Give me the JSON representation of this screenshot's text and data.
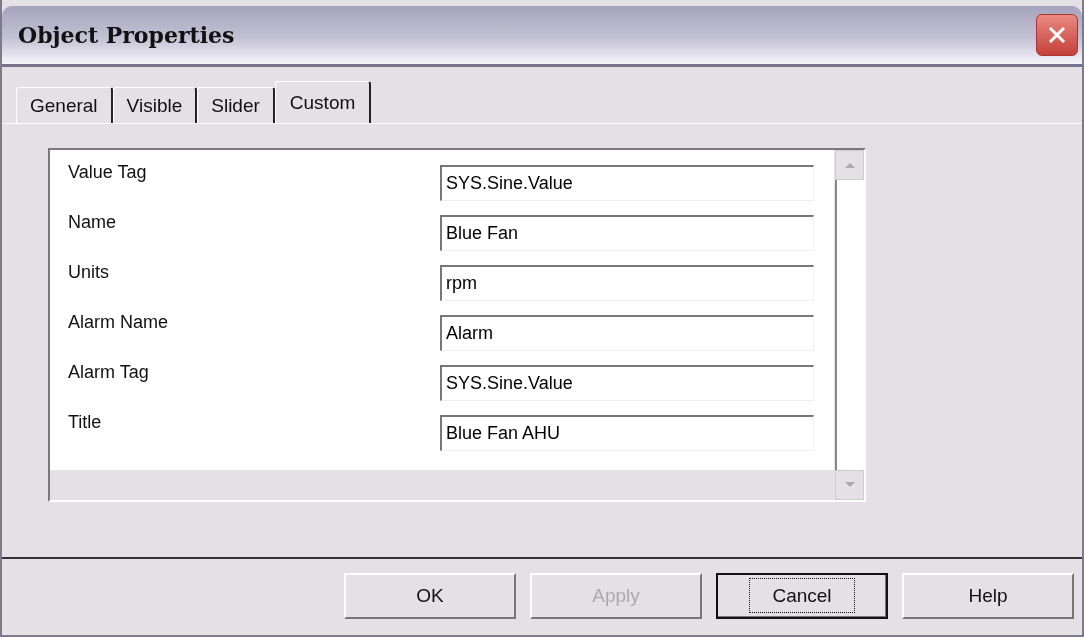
{
  "window": {
    "title": "Object Properties"
  },
  "tabs": [
    {
      "label": "General",
      "selected": false
    },
    {
      "label": "Visible",
      "selected": false
    },
    {
      "label": "Slider",
      "selected": false
    },
    {
      "label": "Custom",
      "selected": true
    }
  ],
  "properties": [
    {
      "label": "Value Tag",
      "value": "SYS.Sine.Value"
    },
    {
      "label": "Name",
      "value": "Blue Fan"
    },
    {
      "label": "Units",
      "value": "rpm"
    },
    {
      "label": "Alarm Name",
      "value": "Alarm"
    },
    {
      "label": "Alarm Tag",
      "value": "SYS.Sine.Value"
    },
    {
      "label": "Title",
      "value": "Blue Fan AHU"
    }
  ],
  "buttons": [
    {
      "label": "OK",
      "disabled": false,
      "focused": false
    },
    {
      "label": "Apply",
      "disabled": true,
      "focused": false
    },
    {
      "label": "Cancel",
      "disabled": false,
      "focused": true
    },
    {
      "label": "Help",
      "disabled": false,
      "focused": false
    }
  ]
}
